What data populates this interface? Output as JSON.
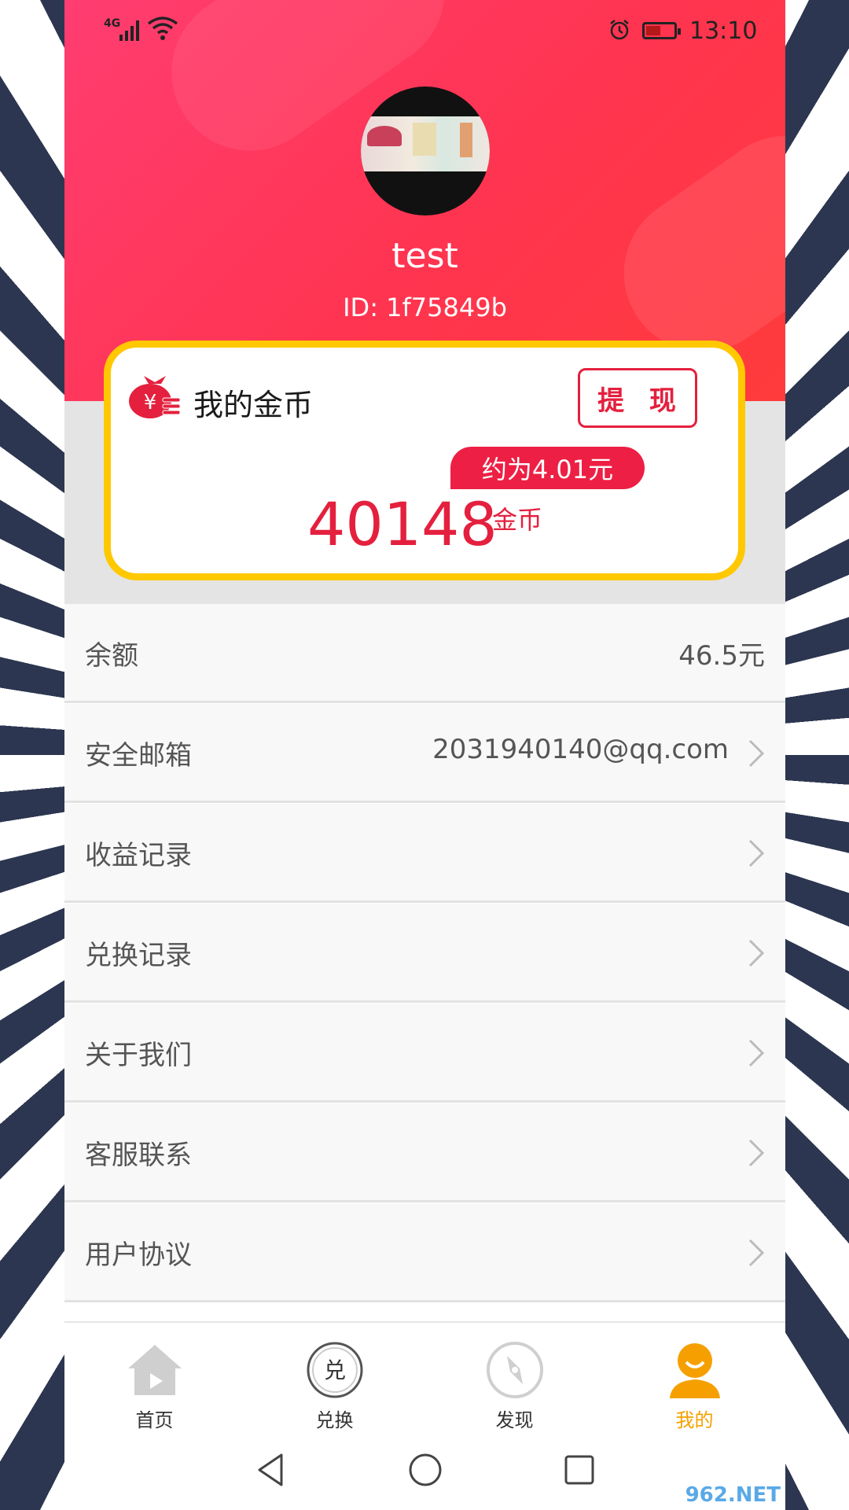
{
  "status_bar": {
    "network": "4G",
    "time": "13:10"
  },
  "profile": {
    "username": "test",
    "user_id": "ID: 1f75849b"
  },
  "coin_card": {
    "title": "我的金币",
    "withdraw_label": "提 现",
    "approx_value": "约为4.01元",
    "amount": "40148",
    "unit": "金币"
  },
  "menu": [
    {
      "label": "余额",
      "value": "46.5元",
      "has_arrow": false
    },
    {
      "label": "安全邮箱",
      "value": "2031940140@qq.com",
      "has_arrow": true
    },
    {
      "label": "收益记录",
      "value": "",
      "has_arrow": true
    },
    {
      "label": "兑换记录",
      "value": "",
      "has_arrow": true
    },
    {
      "label": "关于我们",
      "value": "",
      "has_arrow": true
    },
    {
      "label": "客服联系",
      "value": "",
      "has_arrow": true
    },
    {
      "label": "用户协议",
      "value": "",
      "has_arrow": true
    }
  ],
  "tabs": [
    {
      "label": "首页",
      "icon": "home-icon"
    },
    {
      "label": "兑换",
      "icon": "exchange-icon",
      "icon_text": "兑"
    },
    {
      "label": "发现",
      "icon": "compass-icon"
    },
    {
      "label": "我的",
      "icon": "user-icon",
      "active": true
    }
  ],
  "colors": {
    "header_red": "#ff3450",
    "accent_red": "#e4203e",
    "card_border": "#ffc800",
    "active_tab": "#f5a000"
  },
  "watermark": "962.NET"
}
